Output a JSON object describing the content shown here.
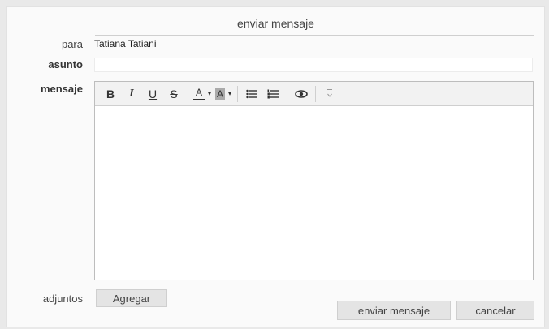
{
  "dialog": {
    "title": "enviar mensaje"
  },
  "form": {
    "to_label": "para",
    "to_value": "Tatiana Tatiani",
    "subject_label": "asunto",
    "subject_value": "",
    "message_label": "mensaje",
    "attachments_label": "adjuntos"
  },
  "toolbar": {
    "bold": "B",
    "italic": "I",
    "underline": "U",
    "strikethrough": "S",
    "font_color": "A",
    "background_color": "A",
    "caret": "▾",
    "bullet_list": "☰",
    "numbered_list": "☷",
    "preview": "◉",
    "more": "⋮"
  },
  "buttons": {
    "add": "Agregar",
    "send": "enviar mensaje",
    "cancel": "cancelar"
  }
}
